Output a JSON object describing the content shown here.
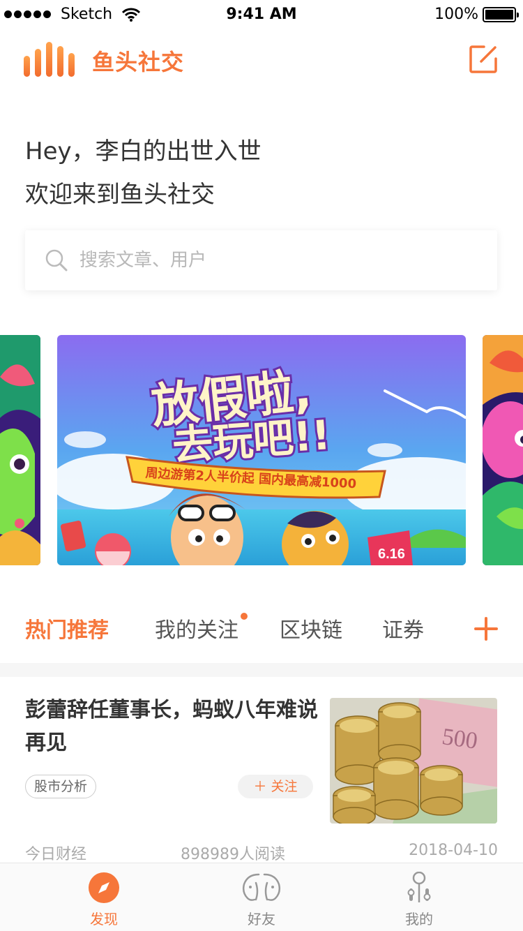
{
  "status_bar": {
    "carrier": "Sketch",
    "time": "9:41 AM",
    "battery": "100%"
  },
  "header": {
    "title": "鱼头社交",
    "compose_icon": "compose-icon",
    "accent": "#f6763a"
  },
  "greeting": {
    "line1": "Hey，李白的出世入世",
    "line2": "欢迎来到鱼头社交"
  },
  "search": {
    "placeholder": "搜索文章、用户",
    "value": ""
  },
  "banner": {
    "headline1": "放假啦,",
    "headline2": "去玩吧!!",
    "ribbon": "周边游第2人半价起  国内最高减1000",
    "flag": "6.16"
  },
  "tabs": [
    {
      "label": "热门推荐",
      "active": true
    },
    {
      "label": "我的关注",
      "active": false,
      "has_dot": true
    },
    {
      "label": "区块链",
      "active": false
    },
    {
      "label": "证券",
      "active": false
    }
  ],
  "article": {
    "title": "彭蕾辞任董事长，蚂蚁八年难说再见",
    "tag": "股市分析",
    "follow_label": "关注",
    "source": "今日财经",
    "reads": "898989人阅读",
    "date": "2018-04-10",
    "banknote_text": "500"
  },
  "tabbar": [
    {
      "label": "发现",
      "icon": "compass-icon",
      "active": true
    },
    {
      "label": "好友",
      "icon": "friends-icon",
      "active": false
    },
    {
      "label": "我的",
      "icon": "profile-icon",
      "active": false
    }
  ]
}
